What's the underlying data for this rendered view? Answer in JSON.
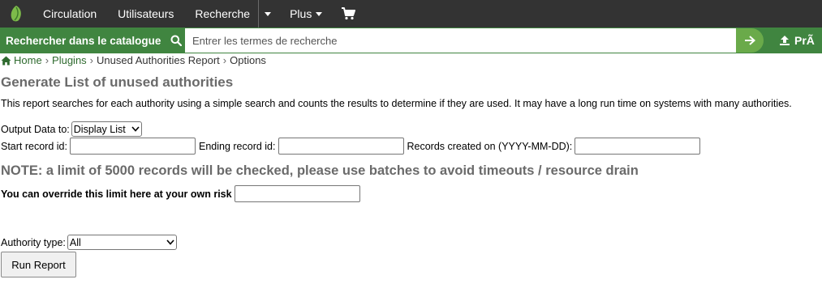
{
  "nav": {
    "items": [
      "Circulation",
      "Utilisateurs",
      "Recherche"
    ],
    "more_label": "Plus",
    "cart_icon": "cart-icon"
  },
  "search": {
    "label": "Rechercher dans le catalogue",
    "placeholder": "Entrer les termes de recherche",
    "pref_label": "PrÃ"
  },
  "breadcrumb": {
    "home": "Home",
    "plugins": "Plugins",
    "report": "Unused Authorities Report",
    "current": "Options",
    "sep": "›"
  },
  "page": {
    "title": "Generate List of unused authorities",
    "description": "This report searches for each authority using a simple search and counts the results to determine if they are used. It may have a long run time on systems with many authorities."
  },
  "form": {
    "output_label": "Output Data to:",
    "output_value": "Display List",
    "start_label": "Start record id:",
    "end_label": "Ending record id:",
    "created_label": "Records created on (YYYY-MM-DD):",
    "note": "NOTE: a limit of 5000 records will be checked, please use batches to avoid timeouts / resource drain",
    "override_label": "You can override this limit here at your own risk",
    "authority_label": "Authority type:",
    "authority_value": "All",
    "run_label": "Run Report"
  },
  "colors": {
    "topbar": "#333333",
    "searchbar": "#408540",
    "go_button": "#6aaa4a",
    "link": "#2e6a2e",
    "heading": "#6a6a6a"
  }
}
